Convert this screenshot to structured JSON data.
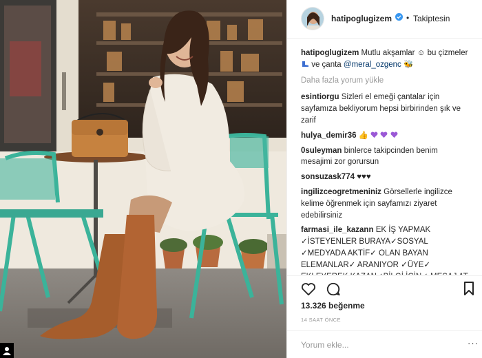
{
  "post": {
    "username": "hatipoglugizem",
    "follow_status": "Takiptesin",
    "dot": "•",
    "caption_user": "hatipoglugizem",
    "caption_text_1": "Mutlu akşamlar ☺ bu çizmeler",
    "caption_text_2": "ve çanta",
    "caption_mention": "@meral_ozgenc",
    "caption_emoji_end": "🐝",
    "load_more": "Daha fazla yorum yükle"
  },
  "comments": [
    {
      "user": "esintiorgu",
      "text": "Sizleri el emeği çantalar için sayfamıza bekliyorum hepsi birbirinden şık ve zarif"
    },
    {
      "user": "hulya_demir36",
      "text": "👍"
    },
    {
      "user": "0suleyman",
      "text": "binlerce takipcinden benim mesajimi zor gorursun"
    },
    {
      "user": "sonsuzask774",
      "text": "♥♥♥"
    },
    {
      "user": "ingilizceogretmeniniz",
      "text": "Görsellerle ingilizce kelime öğrenmek için sayfamızı ziyaret edebilirsiniz"
    },
    {
      "user": "farmasi_ile_kazann",
      "text": "EK İŞ YAPMAK ✓İSTEYENLER BURAYA✓SOSYAL ✓MEDYADA AKTİF✓ OLAN BAYAN ELEMANLAR✓ ARANIYOR ✓ÜYE✓ EKLEYEREK KAZAN✓BİLGİ İCİN✓ MESAJ AT"
    }
  ],
  "stats": {
    "likes": "13.326 beğenme",
    "time": "14 SAAT ÖNCE"
  },
  "add_comment": {
    "placeholder": "Yorum ekle...",
    "more": "···"
  },
  "icons": {
    "verified": "verified-badge-icon",
    "like": "heart-outline-icon",
    "comment": "comment-bubble-icon",
    "save": "bookmark-icon",
    "purple_heart": "purple-heart-emoji",
    "thumbs": "thumbs-up-emoji"
  },
  "colors": {
    "verified_blue": "#3897f0",
    "mention_blue": "#003569",
    "muted_gray": "#999999",
    "heart_purple": "#9b59d6"
  }
}
